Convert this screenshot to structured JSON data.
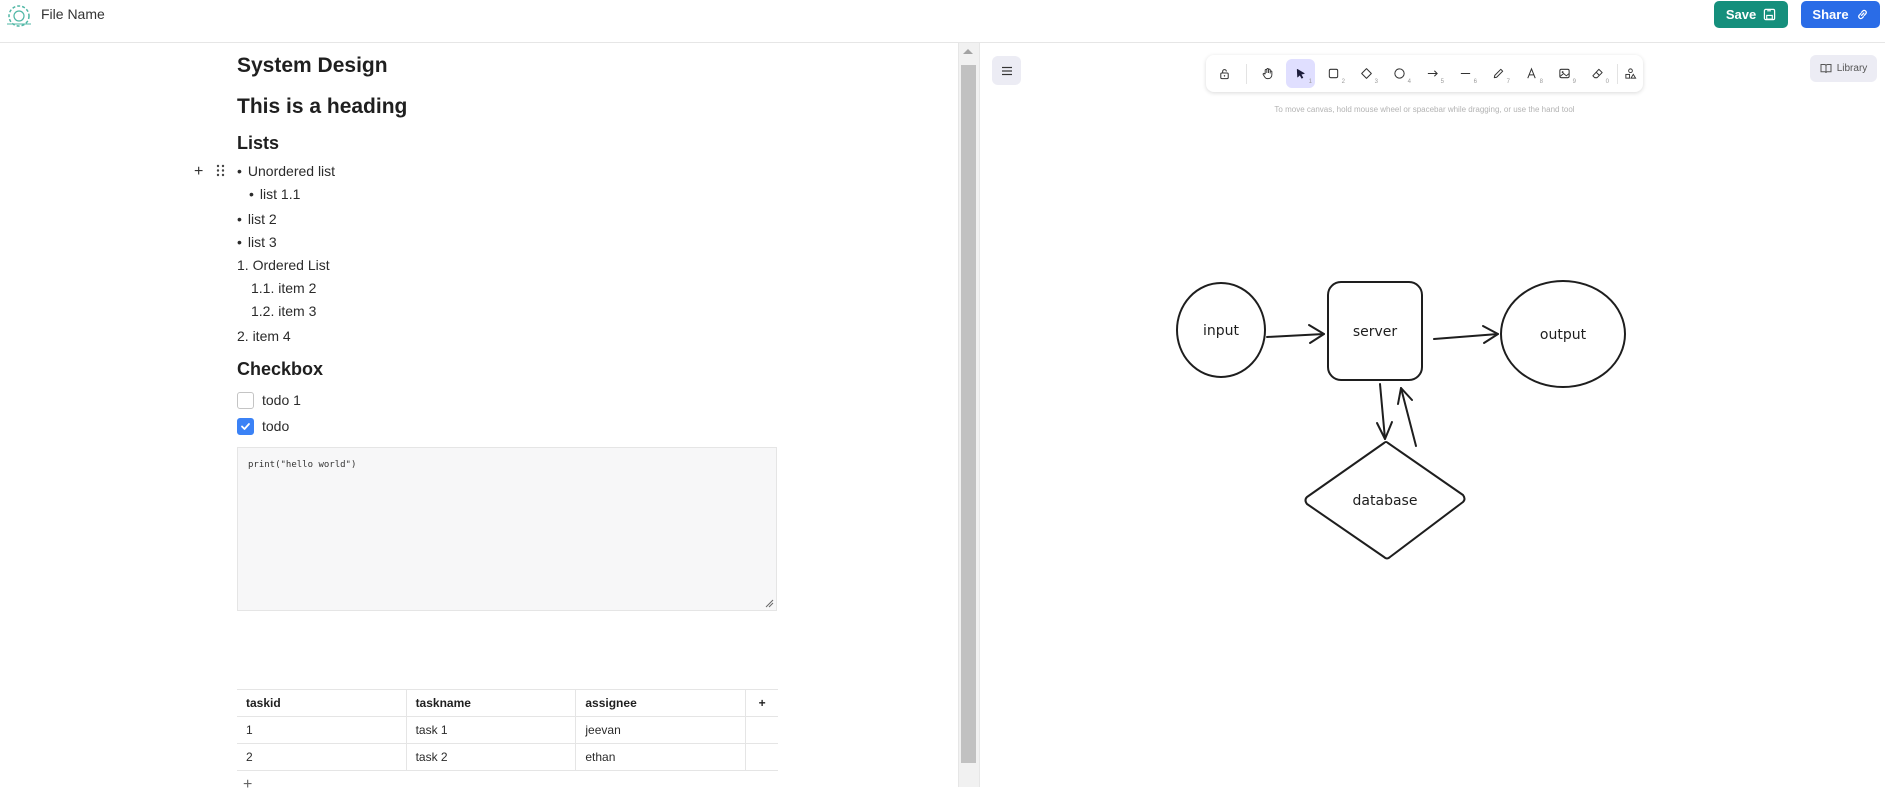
{
  "header": {
    "file_name": "File Name",
    "save_label": "Save",
    "share_label": "Share"
  },
  "doc": {
    "title": "System Design",
    "heading": "This is a heading",
    "lists_heading": "Lists",
    "unordered": [
      "Unordered list",
      "list 1.1",
      "list 2",
      "list 3"
    ],
    "ordered": [
      "1. Ordered List",
      "1.1. item 2",
      "1.2. item 3",
      "2. item 4"
    ],
    "checkbox_heading": "Checkbox",
    "todos": [
      {
        "label": "todo 1",
        "checked": false
      },
      {
        "label": "todo",
        "checked": true
      }
    ],
    "code": "print(\"hello world\")",
    "table": {
      "headers": [
        "taskid",
        "taskname",
        "assignee"
      ],
      "rows": [
        [
          "1",
          "task 1",
          "jeevan"
        ],
        [
          "2",
          "task 2",
          "ethan"
        ]
      ]
    }
  },
  "canvas": {
    "hint": "To move canvas, hold mouse wheel or spacebar while dragging, or use the hand tool",
    "library_label": "Library",
    "tools": [
      {
        "name": "lock-icon",
        "num": ""
      },
      {
        "name": "hand-icon",
        "num": ""
      },
      {
        "name": "selection-icon",
        "num": "1",
        "active": true
      },
      {
        "name": "rectangle-icon",
        "num": "2"
      },
      {
        "name": "diamond-icon",
        "num": "3"
      },
      {
        "name": "ellipse-icon",
        "num": "4"
      },
      {
        "name": "arrow-icon",
        "num": "5"
      },
      {
        "name": "line-icon",
        "num": "6"
      },
      {
        "name": "pencil-icon",
        "num": "7"
      },
      {
        "name": "text-icon",
        "num": "8"
      },
      {
        "name": "image-icon",
        "num": "9"
      },
      {
        "name": "eraser-icon",
        "num": "0"
      },
      {
        "name": "shapes-icon",
        "num": ""
      }
    ],
    "nodes": {
      "input": "input",
      "server": "server",
      "output": "output",
      "database": "database"
    }
  },
  "colors": {
    "save": "#158f7c",
    "share": "#2a6ce7",
    "active_tool": "#e0dfff",
    "checkbox_on": "#3b82f6"
  }
}
